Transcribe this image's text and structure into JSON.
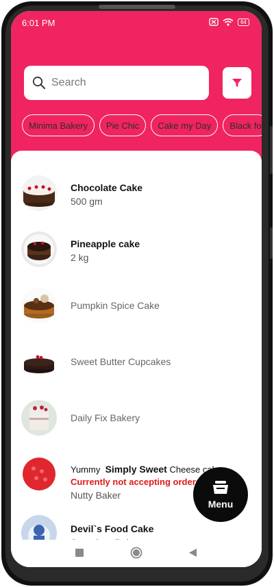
{
  "status_bar": {
    "time": "6:01 PM",
    "battery": "64",
    "icons": [
      "sim-blocked-icon",
      "wifi-icon",
      "battery-icon"
    ]
  },
  "search": {
    "placeholder": "Search",
    "icon": "search-icon"
  },
  "filter": {
    "icon": "filter-icon"
  },
  "chips": [
    "Minima Bakery",
    "Pie Chic",
    "Cake my Day",
    "Black fo"
  ],
  "list": [
    {
      "title": "Chocolate Cake",
      "subtitle": "500 gm"
    },
    {
      "title": "Pineapple cake",
      "subtitle": "2 kg"
    },
    {
      "label": "Pumpkin Spice Cake"
    },
    {
      "label": "Sweet Butter Cupcakes"
    },
    {
      "label": "Daily Fix Bakery"
    },
    {
      "title_prefix": "Yummy",
      "title_bold": "Simply Sweet",
      "title_suffix": "Cheese cake",
      "warning": "Currently not accepting orders onli",
      "subtitle": "Nutty Baker"
    },
    {
      "title": "Devil`s Food Cake",
      "subtitle": "Sugarboo Bakery"
    }
  ],
  "fab": {
    "label": "Menu",
    "icon": "cart-icon"
  },
  "nav": {
    "icons": [
      "recents-square-icon",
      "home-circle-icon",
      "back-triangle-icon"
    ]
  },
  "colors": {
    "accent": "#ef2461",
    "warning": "#e01919",
    "fab": "#0b0b0b"
  }
}
